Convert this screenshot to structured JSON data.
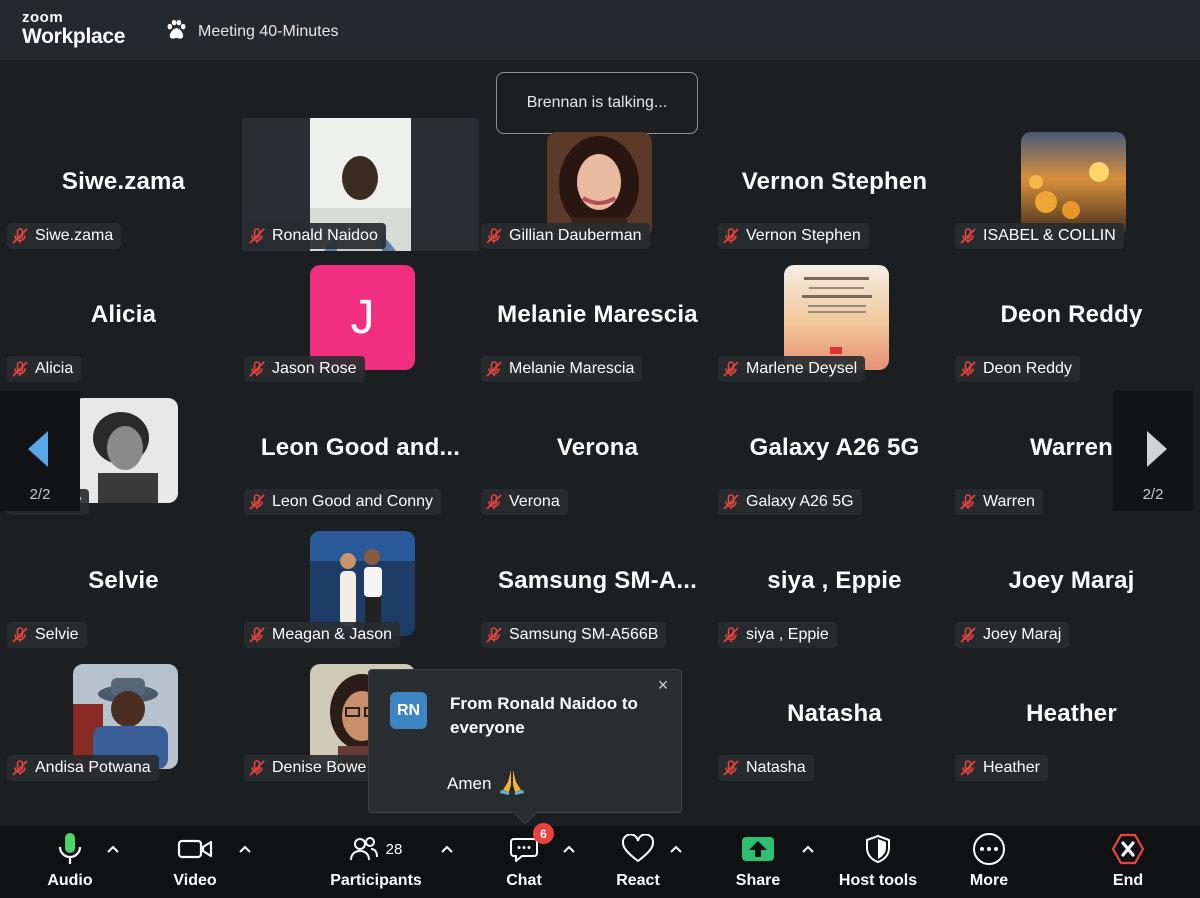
{
  "app": {
    "brand_top": "zoom",
    "brand_bottom": "Workplace"
  },
  "meeting": {
    "title": "Meeting 40-Minutes"
  },
  "toast": {
    "talking": "Brennan is talking..."
  },
  "grid": {
    "tiles": [
      {
        "big": "Siwe.zama",
        "label": "Siwe.zama",
        "kind": "name"
      },
      {
        "big": "",
        "label": "Ronald Naidoo",
        "kind": "video"
      },
      {
        "big": "",
        "label": "Gillian Dauberman",
        "kind": "photo",
        "photo": "woman-curly-hair"
      },
      {
        "big": "Vernon Stephen",
        "label": "Vernon Stephen",
        "kind": "name"
      },
      {
        "big": "",
        "label": "ISABEL & COLLIN",
        "kind": "photo",
        "photo": "sunset-beach"
      },
      {
        "big": "Alicia",
        "label": "Alicia",
        "kind": "name"
      },
      {
        "big": "",
        "label": "Jason Rose",
        "kind": "letter",
        "letter": "J",
        "color": "#f0307f"
      },
      {
        "big": "Melanie Marescia",
        "label": "Melanie Marescia",
        "kind": "name"
      },
      {
        "big": "",
        "label": "Marlene Deysel",
        "kind": "photo",
        "photo": "verse-card"
      },
      {
        "big": "Deon Reddy",
        "label": "Deon Reddy",
        "kind": "name"
      },
      {
        "big": "",
        "label": "Chetty",
        "kind": "photo",
        "photo": "bw-portrait"
      },
      {
        "big": "Leon  Good  and...",
        "label": "Leon Good and Conny",
        "kind": "name"
      },
      {
        "big": "Verona",
        "label": "Verona",
        "kind": "name"
      },
      {
        "big": "Galaxy A26 5G",
        "label": "Galaxy A26 5G",
        "kind": "name"
      },
      {
        "big": "Warren",
        "label": "Warren",
        "kind": "name"
      },
      {
        "big": "Selvie",
        "label": "Selvie",
        "kind": "name"
      },
      {
        "big": "",
        "label": "Meagan & Jason",
        "kind": "photo",
        "photo": "couple"
      },
      {
        "big": "Samsung  SM-A...",
        "label": "Samsung SM-A566B",
        "kind": "name"
      },
      {
        "big": "siya , Eppie",
        "label": "siya , Eppie",
        "kind": "name"
      },
      {
        "big": "Joey Maraj",
        "label": "Joey Maraj",
        "kind": "name"
      },
      {
        "big": "",
        "label": "Andisa Potwana",
        "kind": "photo",
        "photo": "man-hat"
      },
      {
        "big": "",
        "label": "Denise Bowe",
        "kind": "photo",
        "photo": "woman-glasses"
      },
      {
        "big": "",
        "label": "",
        "kind": "hidden"
      },
      {
        "big": "Natasha",
        "label": "Natasha",
        "kind": "name"
      },
      {
        "big": "Heather",
        "label": "Heather",
        "kind": "name"
      }
    ]
  },
  "pager": {
    "left": "2/2",
    "right": "2/2"
  },
  "chat_popup": {
    "initials": "RN",
    "from": "From Ronald Naidoo to everyone",
    "message": "Amen",
    "emoji": "🙏",
    "close": "×"
  },
  "toolbar": {
    "audio": "Audio",
    "video": "Video",
    "participants": "Participants",
    "participants_count": "28",
    "chat": "Chat",
    "chat_badge": "6",
    "react": "React",
    "share": "Share",
    "host_tools": "Host tools",
    "more": "More",
    "end": "End"
  },
  "colors": {
    "share_green": "#2fbf71",
    "end_red": "#e8433f",
    "mic_green": "#4fd26a",
    "accent_blue": "#58a6e8"
  }
}
